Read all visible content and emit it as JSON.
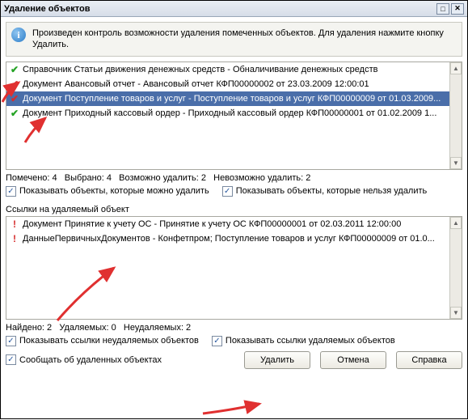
{
  "title": "Удаление объектов",
  "info": "Произведен контроль возможности удаления помеченных объектов. Для удаления нажмите кнопку Удалить.",
  "topList": [
    {
      "mark": "green",
      "glyph": "✔",
      "text": "Справочник Статьи движения денежных средств - Обналичивание денежных средств"
    },
    {
      "mark": "red",
      "glyph": "✔",
      "text": "Документ Авансовый отчет - Авансовый отчет КФП00000002 от 23.03.2009 12:00:01"
    },
    {
      "mark": "red",
      "glyph": "✔",
      "text": "Документ Поступление товаров и услуг - Поступление товаров и услуг КФП00000009 от 01.03.2009..."
    },
    {
      "mark": "green",
      "glyph": "✔",
      "text": "Документ Приходный кассовый ордер - Приходный кассовый ордер КФП00000001 от 01.02.2009 1..."
    }
  ],
  "topSelectedIndex": 2,
  "status1": {
    "marked": "Помечено: 4",
    "selected": "Выбрано: 4",
    "can": "Возможно удалить: 2",
    "cant": "Невозможно удалить: 2"
  },
  "chk1": {
    "a": "Показывать объекты, которые можно удалить",
    "b": "Показывать объекты, которые нельзя удалить"
  },
  "midLabel": "Ссылки на удаляемый объект",
  "botList": [
    {
      "mark": "redbang",
      "glyph": "!",
      "text": "Документ Принятие к учету ОС - Принятие к учету ОС КФП00000001 от 02.03.2011 12:00:00"
    },
    {
      "mark": "redbang",
      "glyph": "!",
      "text": "ДанныеПервичныхДокументов  - Конфетпром; Поступление товаров и услуг КФП00000009 от 01.0..."
    }
  ],
  "status2": {
    "found": "Найдено: 2",
    "del": "Удаляемых: 0",
    "nondel": "Неудаляемых: 2"
  },
  "chk2": {
    "a": "Показывать ссылки неудаляемых объектов",
    "b": "Показывать ссылки удаляемых объектов"
  },
  "chk3": "Сообщать об удаленных объектах",
  "buttons": {
    "delete": "Удалить",
    "cancel": "Отмена",
    "help": "Справка"
  }
}
